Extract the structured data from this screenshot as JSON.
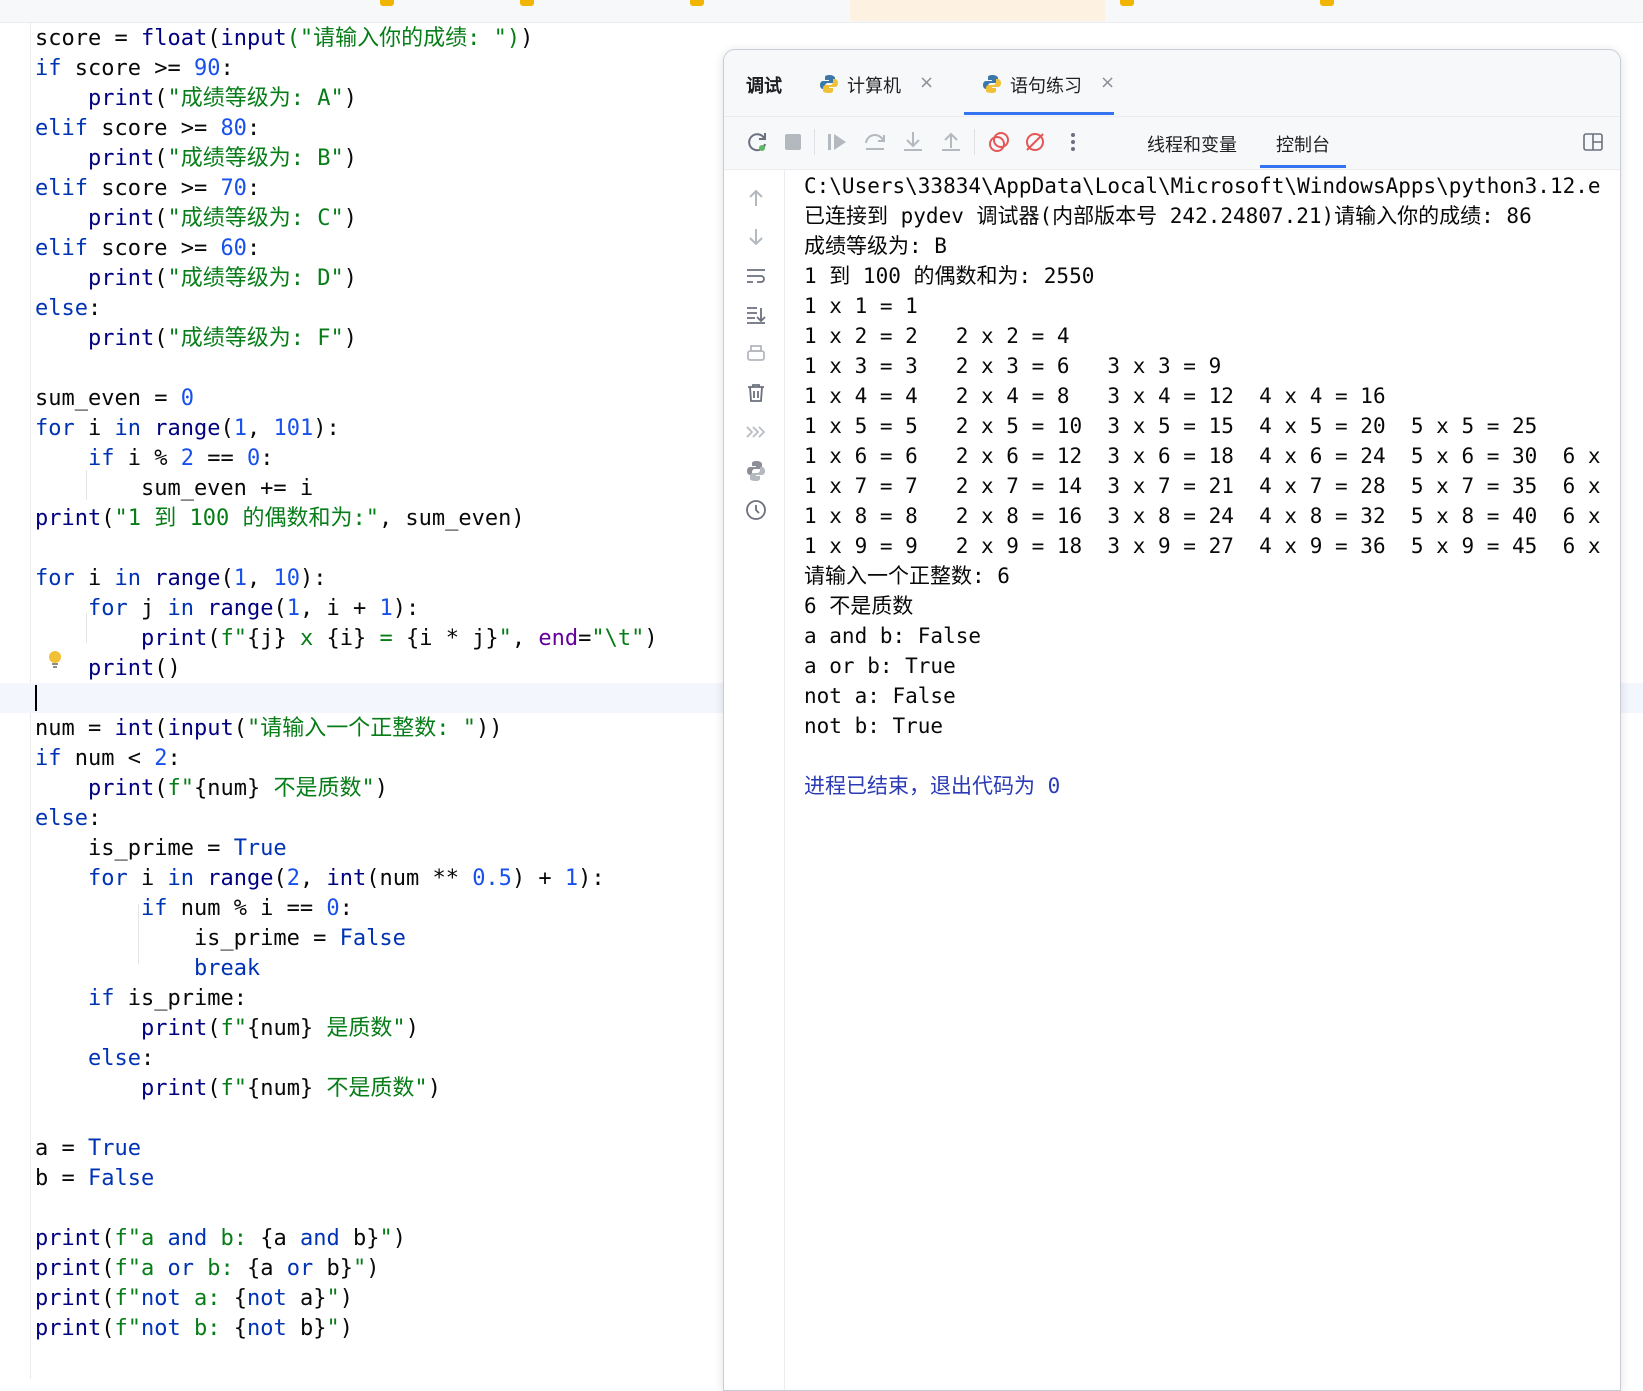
{
  "editor_tabs": [
    "",
    "",
    "",
    "",
    "",
    ""
  ],
  "code_lines": [
    [
      {
        "t": "score = ",
        "c": ""
      },
      {
        "t": "float",
        "c": "fn"
      },
      {
        "t": "(",
        "c": ""
      },
      {
        "t": "input",
        "c": "fn"
      },
      {
        "t": "(\"请输入你的成绩: \")",
        "c": "str"
      },
      {
        "t": ")",
        "c": ""
      }
    ],
    [
      {
        "t": "if",
        "c": "kw"
      },
      {
        "t": " score >= ",
        "c": ""
      },
      {
        "t": "90",
        "c": "num"
      },
      {
        "t": ":",
        "c": ""
      }
    ],
    [
      {
        "t": "    ",
        "c": ""
      },
      {
        "t": "print",
        "c": "fn"
      },
      {
        "t": "(",
        "c": ""
      },
      {
        "t": "\"成绩等级为: A\"",
        "c": "str"
      },
      {
        "t": ")",
        "c": ""
      }
    ],
    [
      {
        "t": "elif",
        "c": "kw"
      },
      {
        "t": " score >= ",
        "c": ""
      },
      {
        "t": "80",
        "c": "num"
      },
      {
        "t": ":",
        "c": ""
      }
    ],
    [
      {
        "t": "    ",
        "c": ""
      },
      {
        "t": "print",
        "c": "fn"
      },
      {
        "t": "(",
        "c": ""
      },
      {
        "t": "\"成绩等级为: B\"",
        "c": "str"
      },
      {
        "t": ")",
        "c": ""
      }
    ],
    [
      {
        "t": "elif",
        "c": "kw"
      },
      {
        "t": " score >= ",
        "c": ""
      },
      {
        "t": "70",
        "c": "num"
      },
      {
        "t": ":",
        "c": ""
      }
    ],
    [
      {
        "t": "    ",
        "c": ""
      },
      {
        "t": "print",
        "c": "fn"
      },
      {
        "t": "(",
        "c": ""
      },
      {
        "t": "\"成绩等级为: C\"",
        "c": "str"
      },
      {
        "t": ")",
        "c": ""
      }
    ],
    [
      {
        "t": "elif",
        "c": "kw"
      },
      {
        "t": " score >= ",
        "c": ""
      },
      {
        "t": "60",
        "c": "num"
      },
      {
        "t": ":",
        "c": ""
      }
    ],
    [
      {
        "t": "    ",
        "c": ""
      },
      {
        "t": "print",
        "c": "fn"
      },
      {
        "t": "(",
        "c": ""
      },
      {
        "t": "\"成绩等级为: D\"",
        "c": "str"
      },
      {
        "t": ")",
        "c": ""
      }
    ],
    [
      {
        "t": "else",
        "c": "kw"
      },
      {
        "t": ":",
        "c": ""
      }
    ],
    [
      {
        "t": "    ",
        "c": ""
      },
      {
        "t": "print",
        "c": "fn"
      },
      {
        "t": "(",
        "c": ""
      },
      {
        "t": "\"成绩等级为: F\"",
        "c": "str"
      },
      {
        "t": ")",
        "c": ""
      }
    ],
    [],
    [
      {
        "t": "sum_even = ",
        "c": ""
      },
      {
        "t": "0",
        "c": "num"
      }
    ],
    [
      {
        "t": "for",
        "c": "kw"
      },
      {
        "t": " i ",
        "c": ""
      },
      {
        "t": "in",
        "c": "kw"
      },
      {
        "t": " ",
        "c": ""
      },
      {
        "t": "range",
        "c": "fn"
      },
      {
        "t": "(",
        "c": ""
      },
      {
        "t": "1",
        "c": "num"
      },
      {
        "t": ", ",
        "c": ""
      },
      {
        "t": "101",
        "c": "num"
      },
      {
        "t": "):",
        "c": ""
      }
    ],
    [
      {
        "t": "    ",
        "c": ""
      },
      {
        "t": "if",
        "c": "kw"
      },
      {
        "t": " i % ",
        "c": ""
      },
      {
        "t": "2",
        "c": "num"
      },
      {
        "t": " == ",
        "c": ""
      },
      {
        "t": "0",
        "c": "num"
      },
      {
        "t": ":",
        "c": ""
      }
    ],
    [
      {
        "t": "        sum_even += i",
        "c": ""
      }
    ],
    [
      {
        "t": "print",
        "c": "fn"
      },
      {
        "t": "(",
        "c": ""
      },
      {
        "t": "\"1 到 100 的偶数和为:\"",
        "c": "str"
      },
      {
        "t": ", sum_even)",
        "c": ""
      }
    ],
    [],
    [
      {
        "t": "for",
        "c": "kw"
      },
      {
        "t": " i ",
        "c": ""
      },
      {
        "t": "in",
        "c": "kw"
      },
      {
        "t": " ",
        "c": ""
      },
      {
        "t": "range",
        "c": "fn"
      },
      {
        "t": "(",
        "c": ""
      },
      {
        "t": "1",
        "c": "num"
      },
      {
        "t": ", ",
        "c": ""
      },
      {
        "t": "10",
        "c": "num"
      },
      {
        "t": "):",
        "c": ""
      }
    ],
    [
      {
        "t": "    ",
        "c": ""
      },
      {
        "t": "for",
        "c": "kw"
      },
      {
        "t": " j ",
        "c": ""
      },
      {
        "t": "in",
        "c": "kw"
      },
      {
        "t": " ",
        "c": ""
      },
      {
        "t": "range",
        "c": "fn"
      },
      {
        "t": "(",
        "c": ""
      },
      {
        "t": "1",
        "c": "num"
      },
      {
        "t": ", i + ",
        "c": ""
      },
      {
        "t": "1",
        "c": "num"
      },
      {
        "t": "):",
        "c": ""
      }
    ],
    [
      {
        "t": "        ",
        "c": ""
      },
      {
        "t": "print",
        "c": "fn"
      },
      {
        "t": "(",
        "c": ""
      },
      {
        "t": "f\"",
        "c": "str"
      },
      {
        "t": "{j}",
        "c": ""
      },
      {
        "t": " x ",
        "c": "str"
      },
      {
        "t": "{i}",
        "c": ""
      },
      {
        "t": " = ",
        "c": "str"
      },
      {
        "t": "{i * j}",
        "c": ""
      },
      {
        "t": "\"",
        "c": "str"
      },
      {
        "t": ", ",
        "c": ""
      },
      {
        "t": "end",
        "c": "kwarg"
      },
      {
        "t": "=",
        "c": ""
      },
      {
        "t": "\"\\t\"",
        "c": "str"
      },
      {
        "t": ")",
        "c": ""
      }
    ],
    [
      {
        "t": "    ",
        "c": ""
      },
      {
        "t": "print",
        "c": "fn"
      },
      {
        "t": "()",
        "c": ""
      }
    ],
    [],
    [
      {
        "t": "num = ",
        "c": ""
      },
      {
        "t": "int",
        "c": "fn"
      },
      {
        "t": "(",
        "c": ""
      },
      {
        "t": "input",
        "c": "fn"
      },
      {
        "t": "(",
        "c": ""
      },
      {
        "t": "\"请输入一个正整数: \"",
        "c": "str"
      },
      {
        "t": "))",
        "c": ""
      }
    ],
    [
      {
        "t": "if",
        "c": "kw"
      },
      {
        "t": " num < ",
        "c": ""
      },
      {
        "t": "2",
        "c": "num"
      },
      {
        "t": ":",
        "c": ""
      }
    ],
    [
      {
        "t": "    ",
        "c": ""
      },
      {
        "t": "print",
        "c": "fn"
      },
      {
        "t": "(",
        "c": ""
      },
      {
        "t": "f\"",
        "c": "str"
      },
      {
        "t": "{num}",
        "c": ""
      },
      {
        "t": " 不是质数\"",
        "c": "str"
      },
      {
        "t": ")",
        "c": ""
      }
    ],
    [
      {
        "t": "else",
        "c": "kw"
      },
      {
        "t": ":",
        "c": ""
      }
    ],
    [
      {
        "t": "    is_prime = ",
        "c": ""
      },
      {
        "t": "True",
        "c": "kw"
      }
    ],
    [
      {
        "t": "    ",
        "c": ""
      },
      {
        "t": "for",
        "c": "kw"
      },
      {
        "t": " i ",
        "c": ""
      },
      {
        "t": "in",
        "c": "kw"
      },
      {
        "t": " ",
        "c": ""
      },
      {
        "t": "range",
        "c": "fn"
      },
      {
        "t": "(",
        "c": ""
      },
      {
        "t": "2",
        "c": "num"
      },
      {
        "t": ", ",
        "c": ""
      },
      {
        "t": "int",
        "c": "fn"
      },
      {
        "t": "(num ** ",
        "c": ""
      },
      {
        "t": "0.5",
        "c": "num"
      },
      {
        "t": ") + ",
        "c": ""
      },
      {
        "t": "1",
        "c": "num"
      },
      {
        "t": "):",
        "c": ""
      }
    ],
    [
      {
        "t": "        ",
        "c": ""
      },
      {
        "t": "if",
        "c": "kw"
      },
      {
        "t": " num % i == ",
        "c": ""
      },
      {
        "t": "0",
        "c": "num"
      },
      {
        "t": ":",
        "c": ""
      }
    ],
    [
      {
        "t": "            is_prime = ",
        "c": ""
      },
      {
        "t": "False",
        "c": "kw"
      }
    ],
    [
      {
        "t": "            ",
        "c": ""
      },
      {
        "t": "break",
        "c": "kw"
      }
    ],
    [
      {
        "t": "    ",
        "c": ""
      },
      {
        "t": "if",
        "c": "kw"
      },
      {
        "t": " is_prime:",
        "c": ""
      }
    ],
    [
      {
        "t": "        ",
        "c": ""
      },
      {
        "t": "print",
        "c": "fn"
      },
      {
        "t": "(",
        "c": ""
      },
      {
        "t": "f\"",
        "c": "str"
      },
      {
        "t": "{num}",
        "c": ""
      },
      {
        "t": " 是质数\"",
        "c": "str"
      },
      {
        "t": ")",
        "c": ""
      }
    ],
    [
      {
        "t": "    ",
        "c": ""
      },
      {
        "t": "else",
        "c": "kw"
      },
      {
        "t": ":",
        "c": ""
      }
    ],
    [
      {
        "t": "        ",
        "c": ""
      },
      {
        "t": "print",
        "c": "fn"
      },
      {
        "t": "(",
        "c": ""
      },
      {
        "t": "f\"",
        "c": "str"
      },
      {
        "t": "{num}",
        "c": ""
      },
      {
        "t": " 不是质数\"",
        "c": "str"
      },
      {
        "t": ")",
        "c": ""
      }
    ],
    [],
    [
      {
        "t": "a = ",
        "c": ""
      },
      {
        "t": "True",
        "c": "kw"
      }
    ],
    [
      {
        "t": "b = ",
        "c": ""
      },
      {
        "t": "False",
        "c": "kw"
      }
    ],
    [],
    [
      {
        "t": "print",
        "c": "fn"
      },
      {
        "t": "(",
        "c": ""
      },
      {
        "t": "f\"a ",
        "c": "str"
      },
      {
        "t": "and",
        "c": "kw"
      },
      {
        "t": " b: ",
        "c": "str"
      },
      {
        "t": "{a ",
        "c": ""
      },
      {
        "t": "and",
        "c": "kw"
      },
      {
        "t": " b}",
        "c": ""
      },
      {
        "t": "\"",
        "c": "str"
      },
      {
        "t": ")",
        "c": ""
      }
    ],
    [
      {
        "t": "print",
        "c": "fn"
      },
      {
        "t": "(",
        "c": ""
      },
      {
        "t": "f\"a ",
        "c": "str"
      },
      {
        "t": "or",
        "c": "kw"
      },
      {
        "t": " b: ",
        "c": "str"
      },
      {
        "t": "{a ",
        "c": ""
      },
      {
        "t": "or",
        "c": "kw"
      },
      {
        "t": " b}",
        "c": ""
      },
      {
        "t": "\"",
        "c": "str"
      },
      {
        "t": ")",
        "c": ""
      }
    ],
    [
      {
        "t": "print",
        "c": "fn"
      },
      {
        "t": "(",
        "c": ""
      },
      {
        "t": "f\"",
        "c": "str"
      },
      {
        "t": "not",
        "c": "kw"
      },
      {
        "t": " a: ",
        "c": "str"
      },
      {
        "t": "{",
        "c": ""
      },
      {
        "t": "not",
        "c": "kw"
      },
      {
        "t": " a}",
        "c": ""
      },
      {
        "t": "\"",
        "c": "str"
      },
      {
        "t": ")",
        "c": ""
      }
    ],
    [
      {
        "t": "print",
        "c": "fn"
      },
      {
        "t": "(",
        "c": ""
      },
      {
        "t": "f\"",
        "c": "str"
      },
      {
        "t": "not",
        "c": "kw"
      },
      {
        "t": " b: ",
        "c": "str"
      },
      {
        "t": "{",
        "c": ""
      },
      {
        "t": "not",
        "c": "kw"
      },
      {
        "t": " b}",
        "c": ""
      },
      {
        "t": "\"",
        "c": "str"
      },
      {
        "t": ")",
        "c": ""
      }
    ]
  ],
  "debug_panel": {
    "title": "调试",
    "tabs": [
      {
        "label": "计算机",
        "active": false
      },
      {
        "label": "语句练习",
        "active": true
      }
    ],
    "sub_tabs": [
      {
        "label": "线程和变量",
        "active": false
      },
      {
        "label": "控制台",
        "active": true
      }
    ],
    "toolbar_icons": [
      "rerun-icon",
      "stop-icon",
      "resume-icon",
      "step-over-icon",
      "step-into-icon",
      "step-out-icon",
      "view-breakpoints-icon",
      "mute-breakpoints-icon",
      "more-icon"
    ],
    "sidebar_icons": [
      "up-arrow-icon",
      "down-arrow-icon",
      "soft-wrap-icon",
      "scroll-to-end-icon",
      "print-icon",
      "trash-icon",
      "more-chevrons-icon",
      "python-console-icon",
      "history-icon"
    ]
  },
  "console_lines": [
    "C:\\Users\\33834\\AppData\\Local\\Microsoft\\WindowsApps\\python3.12.e",
    "已连接到 pydev 调试器(内部版本号 242.24807.21)请输入你的成绩: 86",
    "成绩等级为: B",
    "1 到 100 的偶数和为: 2550",
    "1 x 1 = 1",
    "1 x 2 = 2   2 x 2 = 4",
    "1 x 3 = 3   2 x 3 = 6   3 x 3 = 9",
    "1 x 4 = 4   2 x 4 = 8   3 x 4 = 12  4 x 4 = 16",
    "1 x 5 = 5   2 x 5 = 10  3 x 5 = 15  4 x 5 = 20  5 x 5 = 25",
    "1 x 6 = 6   2 x 6 = 12  3 x 6 = 18  4 x 6 = 24  5 x 6 = 30  6 x",
    "1 x 7 = 7   2 x 7 = 14  3 x 7 = 21  4 x 7 = 28  5 x 7 = 35  6 x",
    "1 x 8 = 8   2 x 8 = 16  3 x 8 = 24  4 x 8 = 32  5 x 8 = 40  6 x",
    "1 x 9 = 9   2 x 9 = 18  3 x 9 = 27  4 x 9 = 36  5 x 9 = 45  6 x",
    "请输入一个正整数: 6",
    "6 不是质数",
    "a and b: False",
    "a or b: True",
    "not a: False",
    "not b: True",
    "",
    "进程已结束，退出代码为 0"
  ]
}
